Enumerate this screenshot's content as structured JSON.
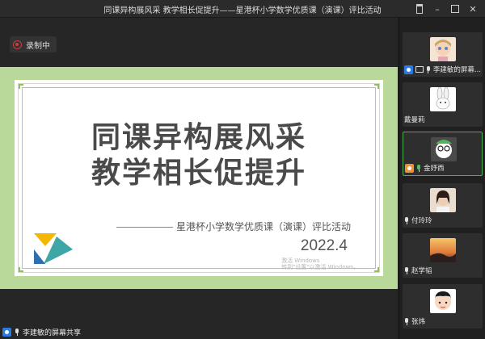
{
  "window": {
    "title": "同课异构展风采 教学相长促提升——星港杯小学数学优质课（演课）评比活动",
    "controls": [
      "pin",
      "minimize",
      "maximize",
      "close"
    ]
  },
  "recording": {
    "label": "录制中",
    "icon": "record-icon",
    "color": "#d23c3c"
  },
  "slide": {
    "title_line1": "同课异构展风采",
    "title_line2": "教学相长促提升",
    "subtitle": "星港杯小学数学优质课（演课）评比活动",
    "date": "2022.4",
    "watermark_line1": "激活 Windows",
    "watermark_line2": "转到\"设置\"以激活 Windows。",
    "bg_color": "#b9d99a",
    "accent_colors": [
      "#f5b800",
      "#3ea6a6",
      "#2d6fb0"
    ]
  },
  "share_bar": {
    "label": "李建敏的屏幕共享"
  },
  "participants": [
    {
      "name": "李建敏的屏幕...",
      "avatar": "cartoon-girl-avatar",
      "badge": "host",
      "screen": true,
      "mic": "on"
    },
    {
      "name": "戴曼莉",
      "avatar": "rabbit-avatar",
      "badge": "",
      "screen": false,
      "mic": ""
    },
    {
      "name": "金妤西",
      "avatar": "green-character-avatar",
      "badge": "orange",
      "screen": false,
      "mic": "green"
    },
    {
      "name": "付玲玲",
      "avatar": "photo-woman-avatar",
      "badge": "",
      "screen": false,
      "mic": "on"
    },
    {
      "name": "赵学韬",
      "avatar": "sunset-avatar",
      "badge": "",
      "screen": false,
      "mic": "on"
    },
    {
      "name": "张炜",
      "avatar": "cartoon-kid-avatar",
      "badge": "",
      "screen": false,
      "mic": "on"
    }
  ]
}
